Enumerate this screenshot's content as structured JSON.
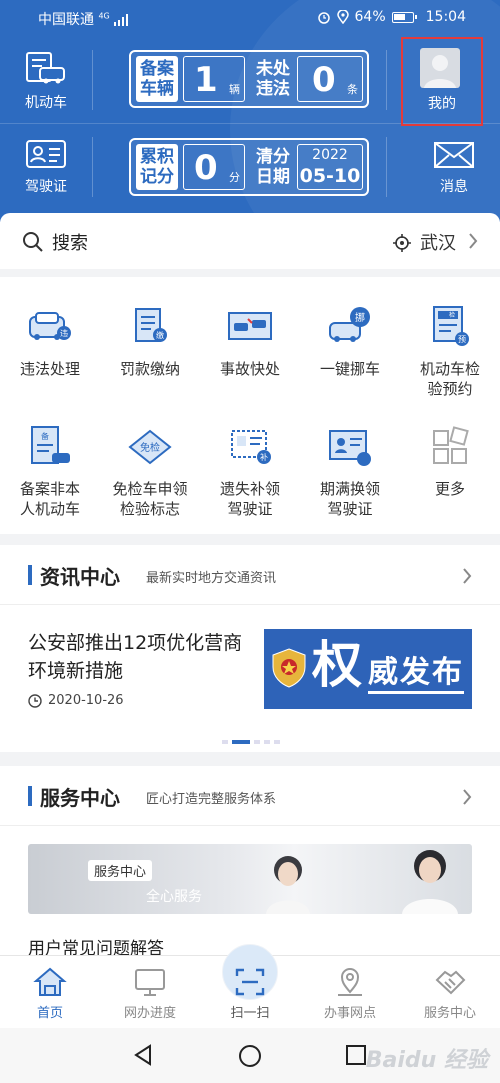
{
  "status_bar": {
    "carrier": "中国联通",
    "signal": "4G",
    "battery": "64%",
    "time": "15:04"
  },
  "header": {
    "vehicle_label": "机动车",
    "license_label": "驾驶证",
    "me_label": "我的",
    "message_label": "消息",
    "plate1": {
      "label_a": "备案",
      "label_b": "车辆",
      "value": "1",
      "unit": "辆",
      "label_c": "未处",
      "label_d": "违法",
      "value2": "0",
      "unit2": "条"
    },
    "plate2": {
      "label_a": "累积",
      "label_b": "记分",
      "value": "0",
      "unit": "分",
      "label_c": "清分",
      "label_d": "日期",
      "year": "2022",
      "date": "05-10"
    }
  },
  "search": {
    "label": "搜索",
    "city": "武汉"
  },
  "services": [
    {
      "label_1": "违法处理",
      "label_2": "",
      "icon": "violation-icon"
    },
    {
      "label_1": "罚款缴纳",
      "label_2": "",
      "icon": "fine-icon"
    },
    {
      "label_1": "事故快处",
      "label_2": "",
      "icon": "accident-icon"
    },
    {
      "label_1": "一键挪车",
      "label_2": "",
      "icon": "move-car-icon"
    },
    {
      "label_1": "机动车检",
      "label_2": "验预约",
      "icon": "inspection-icon"
    },
    {
      "label_1": "备案非本",
      "label_2": "人机动车",
      "icon": "record-car-icon"
    },
    {
      "label_1": "免检车申领",
      "label_2": "检验标志",
      "icon": "exempt-icon"
    },
    {
      "label_1": "遗失补领",
      "label_2": "驾驶证",
      "icon": "reissue-icon"
    },
    {
      "label_1": "期满换领",
      "label_2": "驾驶证",
      "icon": "renew-icon"
    },
    {
      "label_1": "更多",
      "label_2": "",
      "icon": "more-icon"
    }
  ],
  "news_center": {
    "title": "资讯中心",
    "subtitle": "最新实时地方交通资讯",
    "article_title": "公安部推出12项优化营商环境新措施",
    "article_date": "2020-10-26",
    "banner_big": "权",
    "banner_text": "威发布"
  },
  "service_center": {
    "title": "服务中心",
    "subtitle": "匠心打造完整服务体系",
    "banner_badge": "服务中心",
    "banner_slogan": "全心服务",
    "faq": "用户常见问题解答"
  },
  "tabs": [
    {
      "label": "首页",
      "icon": "home-icon"
    },
    {
      "label": "网办进度",
      "icon": "monitor-icon"
    },
    {
      "label": "扫一扫",
      "icon": "scan-icon"
    },
    {
      "label": "办事网点",
      "icon": "location-icon"
    },
    {
      "label": "服务中心",
      "icon": "handshake-icon"
    }
  ],
  "colors": {
    "brand_blue": "#2d6bc0",
    "highlight_red": "#e23b3b"
  },
  "watermark": "Baidu 经验"
}
